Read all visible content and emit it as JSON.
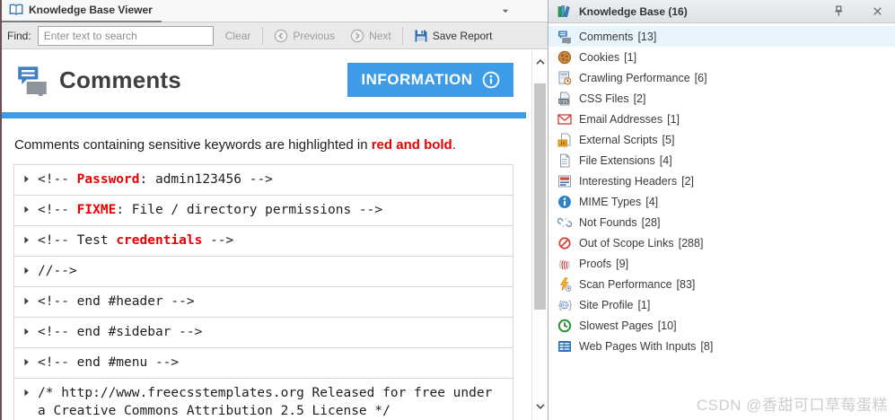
{
  "theme": {
    "accent_blue": "#3d9be8",
    "highlight_red": "#eb0000"
  },
  "window": {
    "tab_title": "Knowledge Base Viewer",
    "tab_icon": "book-icon",
    "dropdown_icon": "chevron-down-icon"
  },
  "find_bar": {
    "label": "Find:",
    "value": "",
    "placeholder": "Enter text to search",
    "clear_label": "Clear",
    "previous_label": "Previous",
    "next_label": "Next",
    "save_report_label": "Save Report",
    "previous_icon": "arrow-left-circle-icon",
    "next_icon": "arrow-right-circle-icon",
    "save_icon": "save-floppy-icon"
  },
  "main": {
    "title": "Comments",
    "title_icon": "comments-icon",
    "info_button_label": "INFORMATION",
    "info_button_icon": "info-circle-icon",
    "description": {
      "prefix": "Comments containing sensitive keywords are highlighted in ",
      "highlight": "red and bold",
      "suffix": "."
    },
    "comments": [
      [
        {
          "text": "<!-- "
        },
        {
          "text": "Password",
          "red": true
        },
        {
          "text": ": admin123456 -->"
        }
      ],
      [
        {
          "text": "<!-- "
        },
        {
          "text": "FIXME",
          "red": true
        },
        {
          "text": ": File / directory permissions -->"
        }
      ],
      [
        {
          "text": "<!-- Test "
        },
        {
          "text": "credentials",
          "red": true
        },
        {
          "text": " -->"
        }
      ],
      [
        {
          "text": "//-->"
        }
      ],
      [
        {
          "text": "<!-- end #header -->"
        }
      ],
      [
        {
          "text": "<!-- end #sidebar -->"
        }
      ],
      [
        {
          "text": "<!-- end #menu -->"
        }
      ],
      [
        {
          "text": "/* http://www.freecsstemplates.org Released for free under a Creative Commons Attribution 2.5 License */"
        }
      ]
    ]
  },
  "sidebar": {
    "title": "Knowledge Base (16)",
    "title_icon": "knowledge-base-books-icon",
    "pin_icon": "pin-icon",
    "close_icon": "close-icon",
    "items": [
      {
        "label": "Comments",
        "count": "[13]",
        "icon": "comments-icon",
        "selected": true
      },
      {
        "label": "Cookies",
        "count": "[1]",
        "icon": "cookie-icon",
        "selected": false
      },
      {
        "label": "Crawling Performance",
        "count": "[6]",
        "icon": "crawling-performance-icon",
        "selected": false
      },
      {
        "label": "CSS Files",
        "count": "[2]",
        "icon": "css-file-icon",
        "selected": false
      },
      {
        "label": "Email Addresses",
        "count": "[1]",
        "icon": "email-icon",
        "selected": false
      },
      {
        "label": "External Scripts",
        "count": "[5]",
        "icon": "script-js-icon",
        "selected": false
      },
      {
        "label": "File Extensions",
        "count": "[4]",
        "icon": "file-icon",
        "selected": false
      },
      {
        "label": "Interesting Headers",
        "count": "[2]",
        "icon": "headers-doc-icon",
        "selected": false
      },
      {
        "label": "MIME Types",
        "count": "[4]",
        "icon": "info-blue-icon",
        "selected": false
      },
      {
        "label": "Not Founds",
        "count": "[28]",
        "icon": "broken-link-icon",
        "selected": false
      },
      {
        "label": "Out of Scope Links",
        "count": "[288]",
        "icon": "out-of-scope-icon",
        "selected": false
      },
      {
        "label": "Proofs",
        "count": "[9]",
        "icon": "fingerprint-icon",
        "selected": false
      },
      {
        "label": "Scan Performance",
        "count": "[83]",
        "icon": "lightning-clock-icon",
        "selected": false
      },
      {
        "label": "Site Profile",
        "count": "[1]",
        "icon": "globe-braces-icon",
        "selected": false
      },
      {
        "label": "Slowest Pages",
        "count": "[10]",
        "icon": "clock-green-icon",
        "selected": false
      },
      {
        "label": "Web Pages With Inputs",
        "count": "[8]",
        "icon": "form-inputs-icon",
        "selected": false
      }
    ]
  },
  "watermark": "CSDN @香甜可口草莓蛋糕"
}
